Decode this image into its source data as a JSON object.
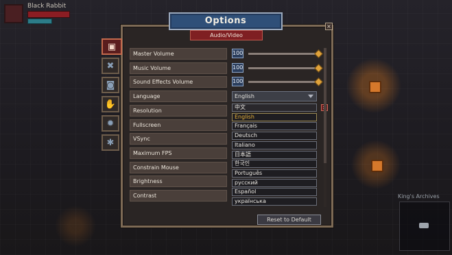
{
  "hud": {
    "player_name": "Black Rabbit"
  },
  "background": {
    "archives_label": "King's Archives"
  },
  "options": {
    "title": "Options",
    "section": "Audio/Video",
    "close_glyph": "×",
    "tabs": [
      {
        "icon": "audio-video-icon",
        "glyph": "▣",
        "active": true
      },
      {
        "icon": "tools-icon",
        "glyph": "✖"
      },
      {
        "icon": "controller-icon",
        "glyph": "◙"
      },
      {
        "icon": "hand-icon",
        "glyph": "✋"
      },
      {
        "icon": "gear-icon",
        "glyph": "✹"
      },
      {
        "icon": "bug-icon",
        "glyph": "✱"
      }
    ],
    "settings": [
      {
        "label": "Master Volume"
      },
      {
        "label": "Music Volume"
      },
      {
        "label": "Sound Effects Volume"
      },
      {
        "label": "Language"
      },
      {
        "label": "Resolution"
      },
      {
        "label": "Fullscreen"
      },
      {
        "label": "VSync"
      },
      {
        "label": "Maximum FPS"
      },
      {
        "label": "Constrain Mouse"
      },
      {
        "label": "Brightness"
      },
      {
        "label": "Contrast"
      }
    ],
    "volumes": [
      {
        "value": "100",
        "fraction": 1.0
      },
      {
        "value": "100",
        "fraction": 1.0
      },
      {
        "value": "100",
        "fraction": 1.0
      }
    ],
    "language_selected": "English",
    "language_options": [
      "中文",
      "English",
      "Français",
      "Deutsch",
      "Italiano",
      "日本語",
      "한국인",
      "Português",
      "русский",
      "Español",
      "українська"
    ],
    "reset_label": "Reset to Default"
  },
  "colors": {
    "banner": "#2f4f78",
    "subbanner": "#7f1f22",
    "selected_option": "#e8b23a",
    "slider_knob": "#e0a23a"
  }
}
